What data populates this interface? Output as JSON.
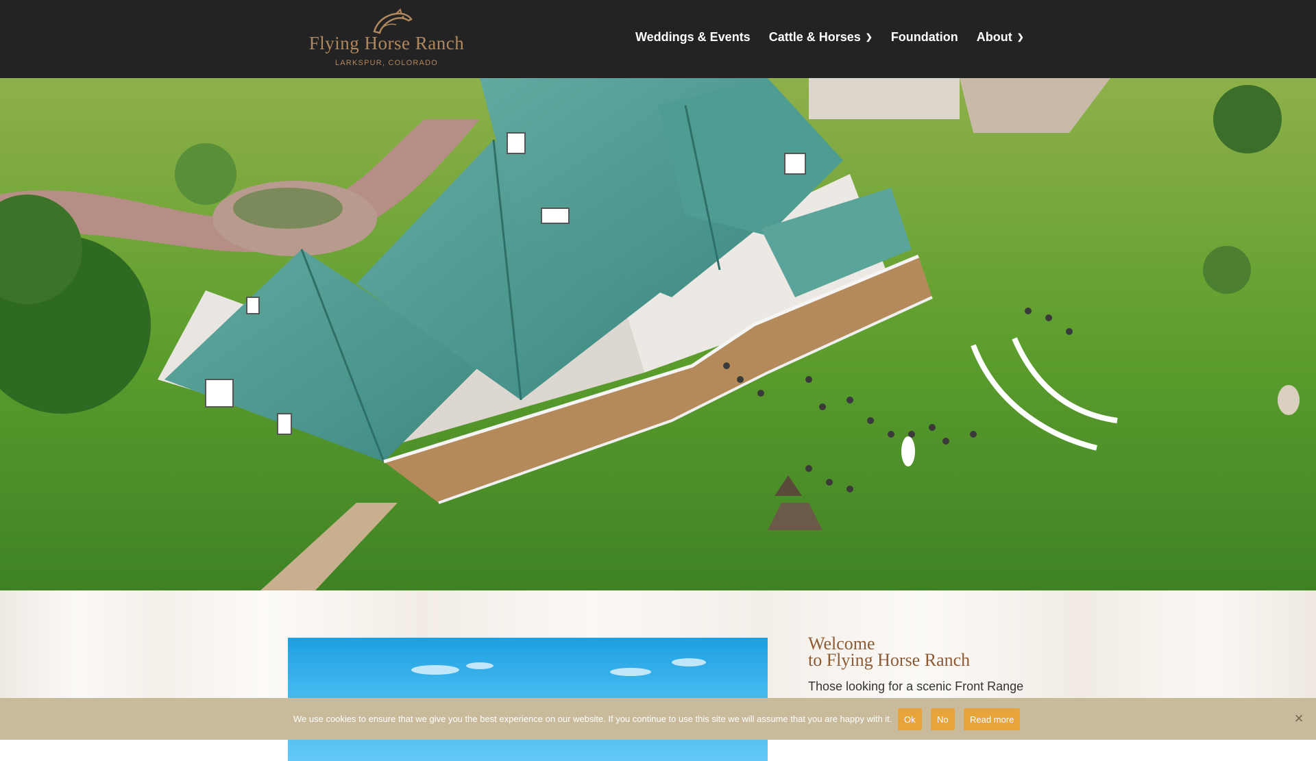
{
  "header": {
    "logo": {
      "title": "Flying Horse Ranch",
      "subtitle": "LARKSPUR, COLORADO",
      "icon": "horse-head-icon",
      "color": "#b0885e"
    },
    "nav": [
      {
        "label": "Weddings & Events",
        "has_dropdown": false
      },
      {
        "label": "Cattle & Horses",
        "has_dropdown": true
      },
      {
        "label": "Foundation",
        "has_dropdown": false
      },
      {
        "label": "About",
        "has_dropdown": true
      }
    ],
    "background": "#232323"
  },
  "hero": {
    "icon": "ranch-aerial-photo"
  },
  "welcome": {
    "title_line1": "Welcome",
    "title_line2": "to Flying Horse Ranch",
    "body": "Those looking for a scenic Front Range",
    "title_color": "#8c5a34"
  },
  "cookie": {
    "text": "We use cookies to ensure that we give you the best experience on our website. If you continue to use this site we will assume that you are happy with it.",
    "ok_label": "Ok",
    "no_label": "No",
    "read_more_label": "Read more",
    "close_icon": "close-icon",
    "button_color": "#e8a33a",
    "bar_color": "#c8ba9b"
  }
}
